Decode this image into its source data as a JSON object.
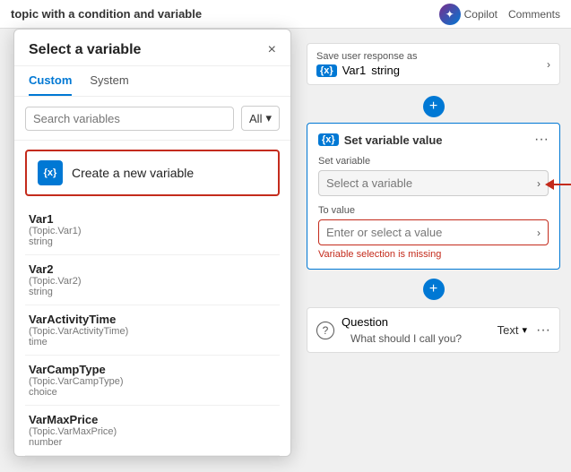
{
  "topbar": {
    "title": "topic with a condition and variable",
    "copilot_label": "Copilot",
    "comments_label": "Comments"
  },
  "panel": {
    "title": "Select a variable",
    "close_label": "×",
    "tabs": [
      {
        "label": "Custom",
        "active": true
      },
      {
        "label": "System",
        "active": false
      }
    ],
    "search_placeholder": "Search variables",
    "filter_label": "All",
    "create_new_label": "Create a new variable",
    "variables": [
      {
        "name": "Var1",
        "topic": "(Topic.Var1)",
        "type": "string"
      },
      {
        "name": "Var2",
        "topic": "(Topic.Var2)",
        "type": "string"
      },
      {
        "name": "VarActivityTime",
        "topic": "(Topic.VarActivityTime)",
        "type": "time"
      },
      {
        "name": "VarCampType",
        "topic": "(Topic.VarCampType)",
        "type": "choice"
      },
      {
        "name": "VarMaxPrice",
        "topic": "(Topic.VarMaxPrice)",
        "type": "number"
      }
    ]
  },
  "right_panel": {
    "save_response_label": "Save user response as",
    "var1_label": "Var1",
    "var1_type": "string",
    "set_variable_title": "Set variable value",
    "set_variable_section_label": "Set variable",
    "select_variable_placeholder": "Select a variable",
    "to_value_label": "To value",
    "enter_value_placeholder": "Enter or select a value",
    "error_text": "Variable selection is missing",
    "question_label": "Question",
    "question_type": "Text",
    "what_should_text": "What should I call you?"
  }
}
